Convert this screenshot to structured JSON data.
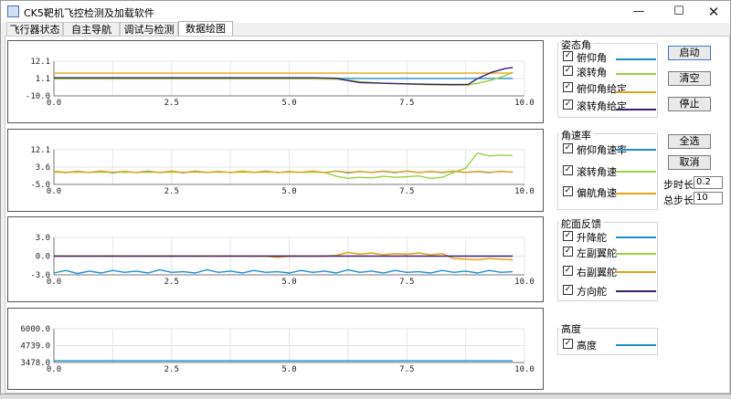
{
  "window": {
    "title": "CK5靶机飞控检测及加载软件"
  },
  "tabs": [
    "飞行器状态",
    "自主导航",
    "调试与检测",
    "数据绘图"
  ],
  "active_tab": 3,
  "groups": {
    "attitude": {
      "title": "姿态角",
      "items": [
        {
          "label": "俯仰角",
          "checked": true,
          "color": "#1f8fcf"
        },
        {
          "label": "滚转角",
          "checked": true,
          "color": "#9ad23c"
        },
        {
          "label": "俯仰角给定",
          "checked": true,
          "color": "#e8a317"
        },
        {
          "label": "滚转角给定",
          "checked": true,
          "color": "#3b1e6e"
        }
      ]
    },
    "rate": {
      "title": "角速率",
      "items": [
        {
          "label": "俯仰角速率",
          "checked": true,
          "color": "#1f8fcf"
        },
        {
          "label": "滚转角速",
          "checked": true,
          "color": "#9ad23c"
        },
        {
          "label": "偏航角速",
          "checked": true,
          "color": "#e8a317"
        }
      ]
    },
    "rudder": {
      "title": "舵面反馈",
      "items": [
        {
          "label": "升降舵",
          "checked": true,
          "color": "#1f8fcf"
        },
        {
          "label": "左副翼舵",
          "checked": true,
          "color": "#9ad23c"
        },
        {
          "label": "右副翼舵",
          "checked": true,
          "color": "#e8a317"
        },
        {
          "label": "方向舵",
          "checked": true,
          "color": "#3b1e6e"
        }
      ]
    },
    "altitude": {
      "title": "高度",
      "items": [
        {
          "label": "高度",
          "checked": true,
          "color": "#1f8fcf"
        }
      ]
    }
  },
  "buttons": {
    "start": "启动",
    "clear": "清空",
    "stop": "停止",
    "select_all": "全选",
    "cancel": "取消"
  },
  "params": {
    "step_time_label": "步时长",
    "step_time_value": "0.2",
    "total_steps_label": "总步长",
    "total_steps_value": "10"
  },
  "chart_data": [
    {
      "type": "line",
      "xlim": [
        0,
        10
      ],
      "x_ticks": [
        "0.0",
        "2.5",
        "5.0",
        "7.5",
        "10.0"
      ],
      "y_ticks": [
        "12.1",
        "1.1",
        "-10.0"
      ],
      "ylim": [
        -10,
        12.1
      ],
      "grid": true,
      "x": [
        0,
        0.5,
        1,
        1.5,
        2,
        2.5,
        3,
        3.5,
        4,
        4.5,
        5,
        5.5,
        6,
        6.2,
        6.5,
        7,
        7.5,
        8,
        8.5,
        8.8,
        9,
        9.3,
        9.6,
        9.75
      ],
      "series": [
        {
          "name": "俯仰角",
          "color": "#1f8fcf",
          "values": [
            1.1,
            1.1,
            1.1,
            1.1,
            1.1,
            1.1,
            1.1,
            1.1,
            1.1,
            1.1,
            1.1,
            1.1,
            1.1,
            1.1,
            1.1,
            1.1,
            1.1,
            1.1,
            1.1,
            1.1,
            1.1,
            1.1,
            1.1,
            1.1
          ]
        },
        {
          "name": "滚转角",
          "color": "#9ad23c",
          "values": [
            0.8,
            0.8,
            0.8,
            0.8,
            0.8,
            0.8,
            0.8,
            0.8,
            0.8,
            0.8,
            0.8,
            0.8,
            0.6,
            0.2,
            -1,
            -2,
            -2.5,
            -3,
            -3.2,
            -3,
            -2,
            0,
            3,
            5
          ]
        },
        {
          "name": "俯仰角给定",
          "color": "#e8a317",
          "values": [
            4.5,
            4.5,
            4.5,
            4.5,
            4.5,
            4.5,
            4.5,
            4.5,
            4.5,
            4.5,
            4.5,
            4.5,
            4.5,
            4.5,
            4.5,
            4.5,
            4.5,
            4.5,
            4.5,
            4.5,
            4.5,
            4.5,
            4.5,
            4.5
          ]
        },
        {
          "name": "滚转角给定",
          "color": "#3b1e6e",
          "values": [
            1.5,
            1.5,
            1.5,
            1.5,
            1.5,
            1.5,
            1.5,
            1.5,
            1.5,
            1.5,
            1.5,
            1.5,
            1.2,
            0,
            -1.5,
            -2,
            -2.3,
            -2.6,
            -2.8,
            -2.8,
            1,
            5,
            7.5,
            8
          ]
        }
      ]
    },
    {
      "type": "line",
      "xlim": [
        0,
        10
      ],
      "x_ticks": [
        "0.0",
        "2.5",
        "5.0",
        "7.5",
        "10.0"
      ],
      "y_ticks": [
        "12.1",
        "3.6",
        "-5.0"
      ],
      "ylim": [
        -5,
        12.1
      ],
      "grid": true,
      "x": [
        0,
        0.25,
        0.5,
        0.75,
        1,
        1.25,
        1.5,
        1.75,
        2,
        2.25,
        2.5,
        2.75,
        3,
        3.25,
        3.5,
        3.75,
        4,
        4.25,
        4.5,
        4.75,
        5,
        5.25,
        5.5,
        5.75,
        6,
        6.25,
        6.5,
        6.75,
        7,
        7.25,
        7.5,
        7.75,
        8,
        8.25,
        8.5,
        8.75,
        9,
        9.25,
        9.5,
        9.75
      ],
      "series": [
        {
          "name": "俯仰角速率",
          "color": "#1f8fcf",
          "values": [
            1.4,
            0.8,
            1.5,
            0.9,
            1.6,
            0.7,
            1.4,
            0.9,
            1.6,
            0.8,
            1.5,
            0.7,
            1.6,
            0.9,
            1.4,
            0.8,
            1.5,
            0.9,
            1.6,
            0.8,
            1.4,
            0.9,
            1.5,
            0.8,
            1.6,
            0.7,
            1.4,
            0.9,
            1.5,
            0.8,
            1.6,
            0.9,
            1.4,
            0.8,
            1.5,
            0.9,
            1.4,
            0.8,
            1.5,
            1.0
          ]
        },
        {
          "name": "滚转角速",
          "color": "#9ad23c",
          "values": [
            1.0,
            1.0,
            1.0,
            1.0,
            1.0,
            1.0,
            1.0,
            1.0,
            1.0,
            1.0,
            1.0,
            1.0,
            1.0,
            1.0,
            1.0,
            1.0,
            1.0,
            1.0,
            1.0,
            1.0,
            1.0,
            1.0,
            1.0,
            1.0,
            -1.0,
            -2.0,
            -1.5,
            -1.8,
            -1.0,
            -1.5,
            -1.2,
            -0.8,
            -2.0,
            -1.5,
            1.0,
            3.0,
            10.5,
            9.0,
            9.5,
            9.2
          ]
        },
        {
          "name": "偏航角速",
          "color": "#e8a317",
          "values": [
            1.5,
            1.0,
            1.4,
            0.9,
            1.6,
            1.0,
            1.5,
            0.8,
            1.4,
            1.0,
            1.6,
            0.9,
            1.5,
            1.0,
            1.4,
            0.9,
            1.6,
            1.0,
            1.5,
            0.8,
            1.4,
            1.0,
            1.6,
            0.9,
            1.5,
            1.0,
            1.4,
            0.9,
            1.6,
            1.0,
            1.5,
            0.8,
            1.4,
            1.0,
            1.6,
            0.9,
            1.5,
            1.0,
            1.4,
            1.1
          ]
        }
      ]
    },
    {
      "type": "line",
      "xlim": [
        0,
        10
      ],
      "x_ticks": [
        "0.0",
        "2.5",
        "5.0",
        "7.5",
        "10.0"
      ],
      "y_ticks": [
        "3.0",
        "0.0",
        "-3.0"
      ],
      "ylim": [
        -3,
        3
      ],
      "grid": true,
      "x": [
        0,
        0.25,
        0.5,
        0.75,
        1,
        1.25,
        1.5,
        1.75,
        2,
        2.25,
        2.5,
        2.75,
        3,
        3.25,
        3.5,
        3.75,
        4,
        4.25,
        4.5,
        4.75,
        5,
        5.25,
        5.5,
        5.75,
        6,
        6.25,
        6.5,
        6.75,
        7,
        7.25,
        7.5,
        7.75,
        8,
        8.25,
        8.5,
        8.75,
        9,
        9.25,
        9.5,
        9.75
      ],
      "series": [
        {
          "name": "升降舵",
          "color": "#1f8fcf",
          "values": [
            -2.7,
            -2.3,
            -2.8,
            -2.4,
            -2.7,
            -2.3,
            -2.6,
            -2.4,
            -2.7,
            -2.2,
            -2.6,
            -2.5,
            -2.7,
            -2.2,
            -2.6,
            -2.4,
            -2.7,
            -2.3,
            -2.6,
            -2.5,
            -2.7,
            -2.3,
            -2.6,
            -2.4,
            -2.7,
            -2.2,
            -2.6,
            -2.4,
            -2.7,
            -2.3,
            -2.6,
            -2.5,
            -2.7,
            -2.3,
            -2.6,
            -2.4,
            -2.7,
            -2.3,
            -2.6,
            -2.5
          ]
        },
        {
          "name": "左副翼舵",
          "color": "#9ad23c",
          "values": [
            0,
            0,
            0,
            0,
            0,
            0,
            0,
            0,
            0,
            0,
            0,
            0,
            0,
            0,
            0,
            0,
            0,
            0,
            0,
            0,
            0,
            0,
            0,
            0,
            0.1,
            0.6,
            0.3,
            0.5,
            0.2,
            0.4,
            0.3,
            0.5,
            0.2,
            0.4,
            -0.4,
            -0.5,
            -0.6,
            -0.4,
            -0.5,
            -0.6
          ]
        },
        {
          "name": "右副翼舵",
          "color": "#e8a317",
          "values": [
            0,
            0,
            0,
            0,
            0,
            0,
            0,
            0,
            0,
            0,
            0,
            0,
            0,
            0,
            0,
            0,
            0,
            0,
            0,
            -0.2,
            0,
            0,
            0,
            0,
            0.1,
            0.6,
            0.3,
            0.5,
            0.2,
            0.4,
            0.3,
            0.5,
            0.2,
            0.4,
            -0.4,
            -0.5,
            -0.6,
            -0.4,
            -0.5,
            -0.6
          ]
        },
        {
          "name": "方向舵",
          "color": "#3b1e6e",
          "values": [
            0,
            0,
            0,
            0,
            0,
            0,
            0,
            0,
            0,
            0,
            0,
            0,
            0,
            0,
            0,
            0,
            0,
            0,
            0,
            0,
            0,
            0,
            0,
            0,
            0,
            0,
            0,
            0,
            0,
            0,
            0,
            0,
            0,
            0,
            0,
            0,
            0,
            0,
            0,
            0
          ]
        }
      ]
    },
    {
      "type": "line",
      "xlim": [
        0,
        10
      ],
      "x_ticks": [
        "0.0",
        "2.5",
        "5.0",
        "7.5",
        "10.0"
      ],
      "y_ticks": [
        "6000.0",
        "4739.0",
        "3478.0"
      ],
      "ylim": [
        3478,
        6000
      ],
      "grid": true,
      "x": [
        0,
        9.75
      ],
      "series": [
        {
          "name": "高度",
          "color": "#1f8fcf",
          "values": [
            3600,
            3600
          ]
        }
      ]
    }
  ]
}
